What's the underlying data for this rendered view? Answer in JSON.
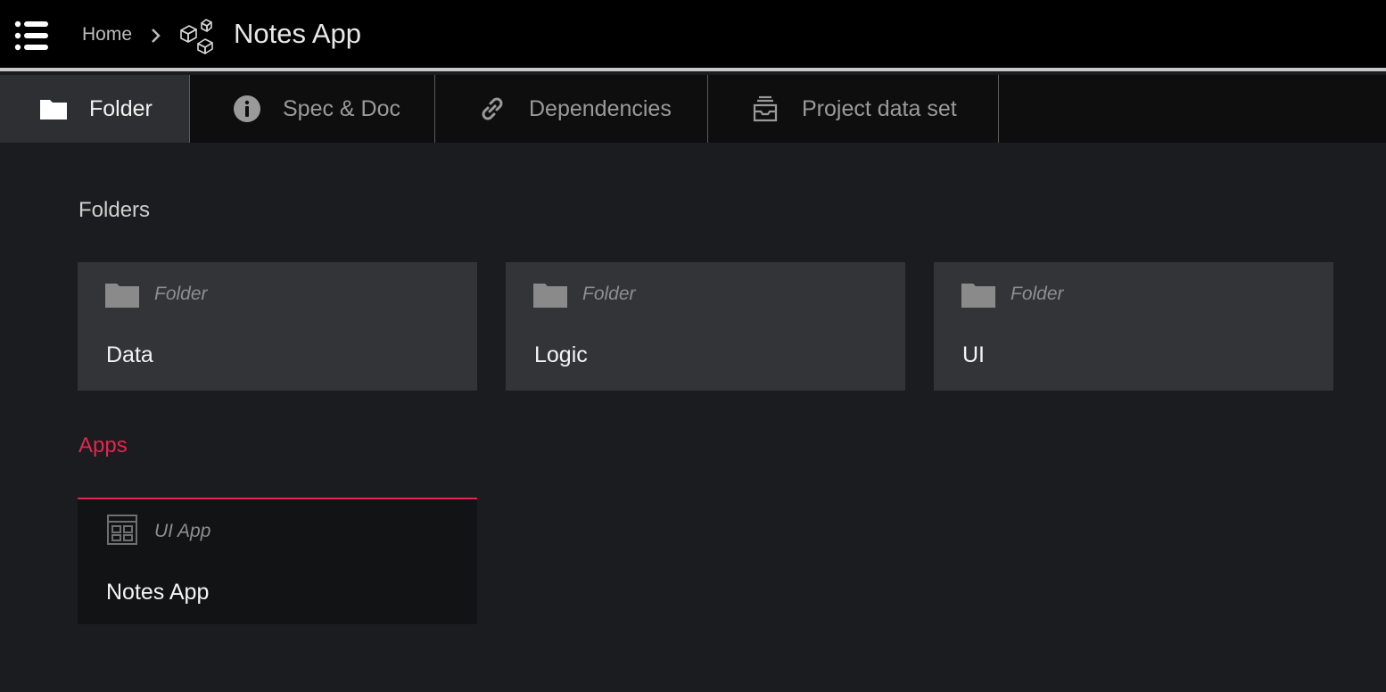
{
  "header": {
    "breadcrumb_home": "Home",
    "title": "Notes App",
    "icons": {
      "menu": "list-menu-icon",
      "separator": "chevron-right-icon",
      "project": "cubes-icon"
    }
  },
  "tabs": [
    {
      "label": "Folder",
      "icon": "folder-icon",
      "active": true
    },
    {
      "label": "Spec & Doc",
      "icon": "info-icon",
      "active": false
    },
    {
      "label": "Dependencies",
      "icon": "link-icon",
      "active": false
    },
    {
      "label": "Project data set",
      "icon": "inbox-stack-icon",
      "active": false
    }
  ],
  "sections": {
    "folders_title": "Folders",
    "apps_title": "Apps"
  },
  "folders": [
    {
      "type": "Folder",
      "name": "Data",
      "icon": "folder-icon"
    },
    {
      "type": "Folder",
      "name": "Logic",
      "icon": "folder-icon"
    },
    {
      "type": "Folder",
      "name": "UI",
      "icon": "folder-icon"
    }
  ],
  "apps": [
    {
      "type": "UI App",
      "name": "Notes App",
      "icon": "ui-app-grid-icon"
    }
  ],
  "colors": {
    "accent": "#e2264f",
    "background": "#1b1c1f",
    "topbar": "#000000",
    "card": "#333438",
    "app_card": "#121315"
  }
}
